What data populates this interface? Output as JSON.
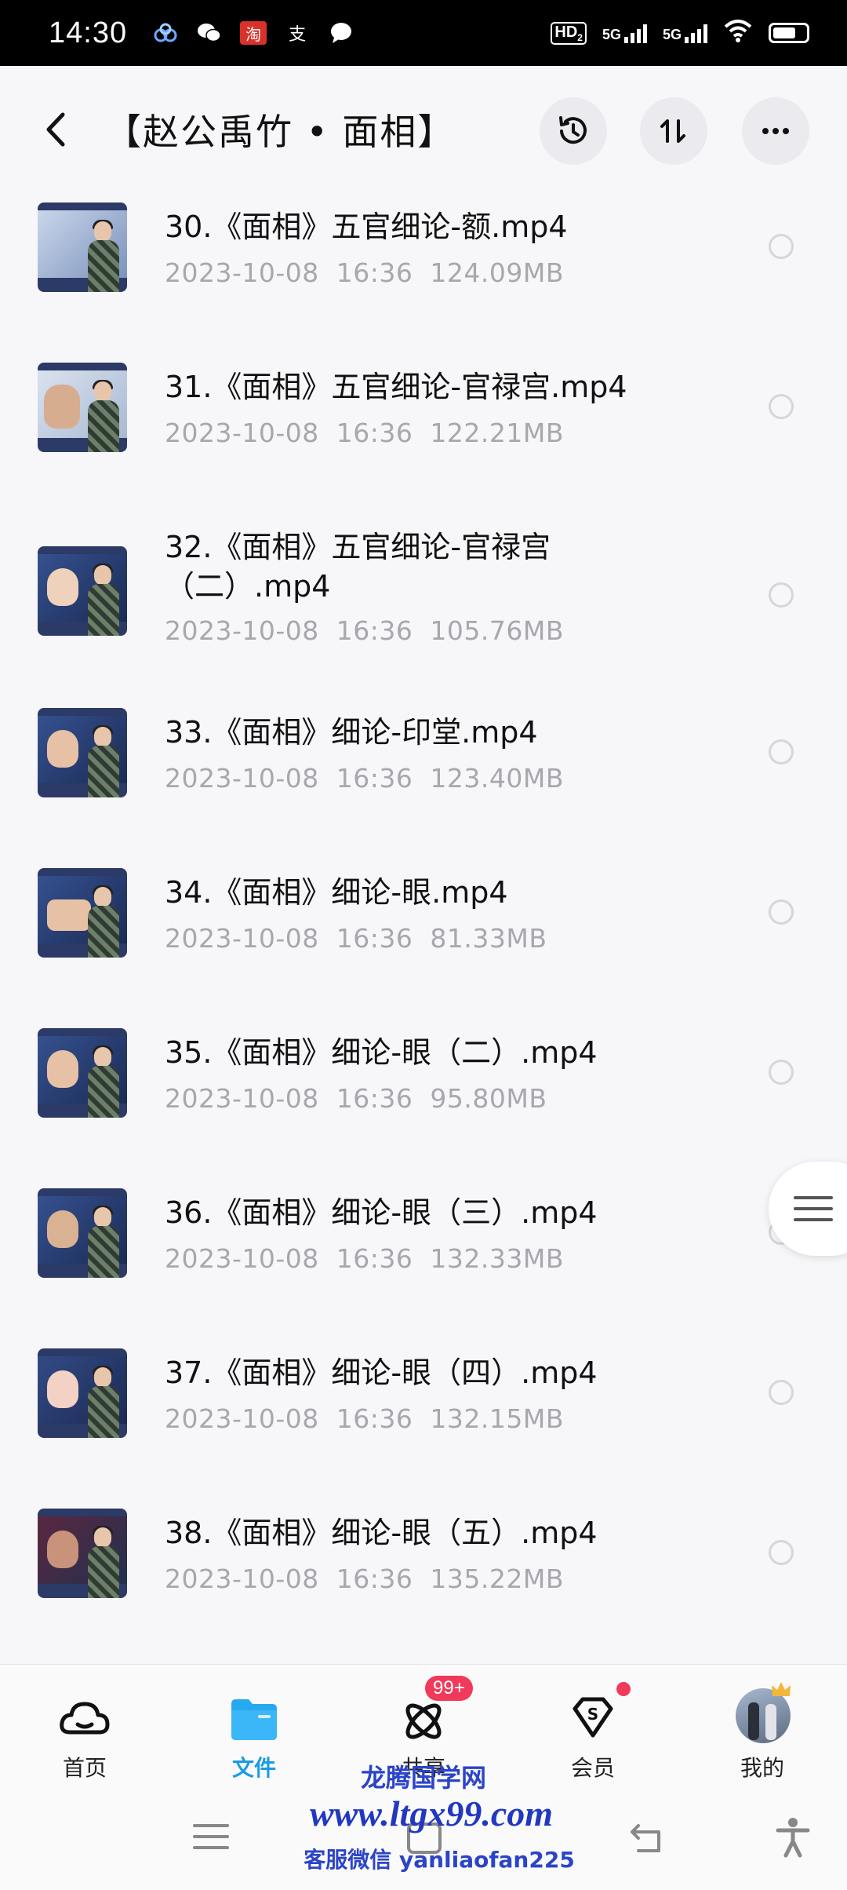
{
  "status_bar": {
    "time": "14:30",
    "app_icons": [
      "cluster-icon",
      "wechat-icon",
      "taobao-icon",
      "alipay-icon",
      "message-icon"
    ],
    "taobao_glyph": "淘",
    "alipay_glyph": "支",
    "hd_label": "HD",
    "hd_sub": "2",
    "net_1": "5G",
    "net_2": "5G"
  },
  "header": {
    "title": "【赵公禹竹 • 面相】",
    "buttons": [
      "history-icon",
      "sort-icon",
      "more-icon"
    ]
  },
  "files": [
    {
      "name": "30.《面相》五官细论-额.mp4",
      "date": "2023-10-08",
      "time": "16:36",
      "size": "124.09MB"
    },
    {
      "name": "31.《面相》五官细论-官禄宫.mp4",
      "date": "2023-10-08",
      "time": "16:36",
      "size": "122.21MB"
    },
    {
      "name": "32.《面相》五官细论-官禄宫",
      "name_line2": "（二）.mp4",
      "date": "2023-10-08",
      "time": "16:36",
      "size": "105.76MB"
    },
    {
      "name": "33.《面相》细论-印堂.mp4",
      "date": "2023-10-08",
      "time": "16:36",
      "size": "123.40MB"
    },
    {
      "name": "34.《面相》细论-眼.mp4",
      "date": "2023-10-08",
      "time": "16:36",
      "size": "81.33MB"
    },
    {
      "name": "35.《面相》细论-眼（二）.mp4",
      "date": "2023-10-08",
      "time": "16:36",
      "size": "95.80MB"
    },
    {
      "name": "36.《面相》细论-眼（三）.mp4",
      "date": "2023-10-08",
      "time": "16:36",
      "size": "132.33MB"
    },
    {
      "name": "37.《面相》细论-眼（四）.mp4",
      "date": "2023-10-08",
      "time": "16:36",
      "size": "132.15MB"
    },
    {
      "name": "38.《面相》细论-眼（五）.mp4",
      "date": "2023-10-08",
      "time": "16:36",
      "size": "135.22MB"
    }
  ],
  "bottom_nav": {
    "items": [
      {
        "label": "首页",
        "icon": "cloud-icon"
      },
      {
        "label": "文件",
        "icon": "folder-icon",
        "active": true
      },
      {
        "label": "共享",
        "icon": "share-atom-icon",
        "badge": "99+"
      },
      {
        "label": "会员",
        "icon": "vip-diamond-icon"
      },
      {
        "label": "我的",
        "icon": "avatar"
      }
    ]
  },
  "watermark": {
    "line1": "龙腾国学网",
    "line2": "www.ltgx99.com",
    "line3": "客服微信 yanliaofan225"
  },
  "colors": {
    "accent": "#1a9be6",
    "badge": "#f0395b",
    "meta_text": "#a6a8ae",
    "watermark": "#2b44c8"
  }
}
